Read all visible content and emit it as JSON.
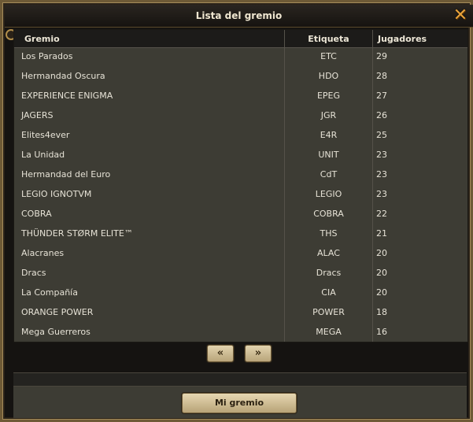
{
  "window": {
    "title": "Lista del gremio"
  },
  "table": {
    "columns": [
      "Gremio",
      "Etiqueta",
      "Jugadores"
    ],
    "rows": [
      [
        "Los Parados",
        "ETC",
        "29"
      ],
      [
        "Hermandad Oscura",
        "HDO",
        "28"
      ],
      [
        "EXPERIENCE ENIGMA",
        "EPEG",
        "27"
      ],
      [
        "JAGERS",
        "JGR",
        "26"
      ],
      [
        "Elites4ever",
        "E4R",
        "25"
      ],
      [
        "La Unidad",
        "UNIT",
        "23"
      ],
      [
        "Hermandad del Euro",
        "CdT",
        "23"
      ],
      [
        "LEGIO IGNOTVM",
        "LEGIO",
        "23"
      ],
      [
        "COBRA",
        "COBRA",
        "22"
      ],
      [
        "THÜNDER STØRM ELITE™",
        "THS",
        "21"
      ],
      [
        "Alacranes",
        "ALAC",
        "20"
      ],
      [
        "Dracs",
        "Dracs",
        "20"
      ],
      [
        "La Compañía",
        "CIA",
        "20"
      ],
      [
        "ORANGE POWER",
        "POWER",
        "18"
      ],
      [
        "Mega Guerreros",
        "MEGA",
        "16"
      ]
    ]
  },
  "pagination": {
    "prev_label": "«",
    "next_label": "»"
  },
  "footer": {
    "my_guild_label": "Mi gremio"
  },
  "icons": {
    "close": "close-icon"
  },
  "colors": {
    "accent": "#e8a23a",
    "panel": "#3d3c34",
    "text": "#e6e2d6"
  }
}
